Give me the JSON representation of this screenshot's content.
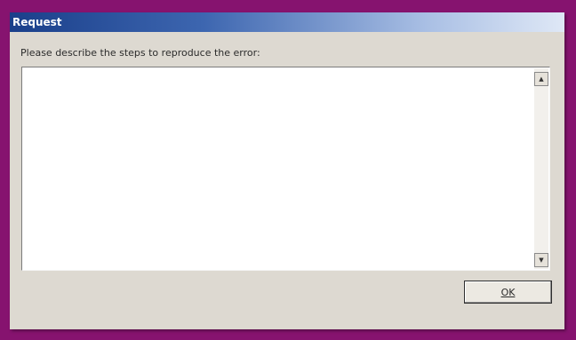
{
  "window": {
    "title": "Request"
  },
  "form": {
    "prompt": "Please describe the steps to reproduce the error:",
    "steps_value": "",
    "scroll_up_glyph": "▲",
    "scroll_down_glyph": "▼"
  },
  "buttons": {
    "ok_label": "OK"
  },
  "colors": {
    "desktop_background": "#86136f",
    "titlebar_start": "#1a3f8a",
    "titlebar_end": "#dfe8f6",
    "dialog_face": "#ddd9d1"
  },
  "icons": {
    "scroll_up": "scroll-up-arrow-icon",
    "scroll_down": "scroll-down-arrow-icon"
  }
}
